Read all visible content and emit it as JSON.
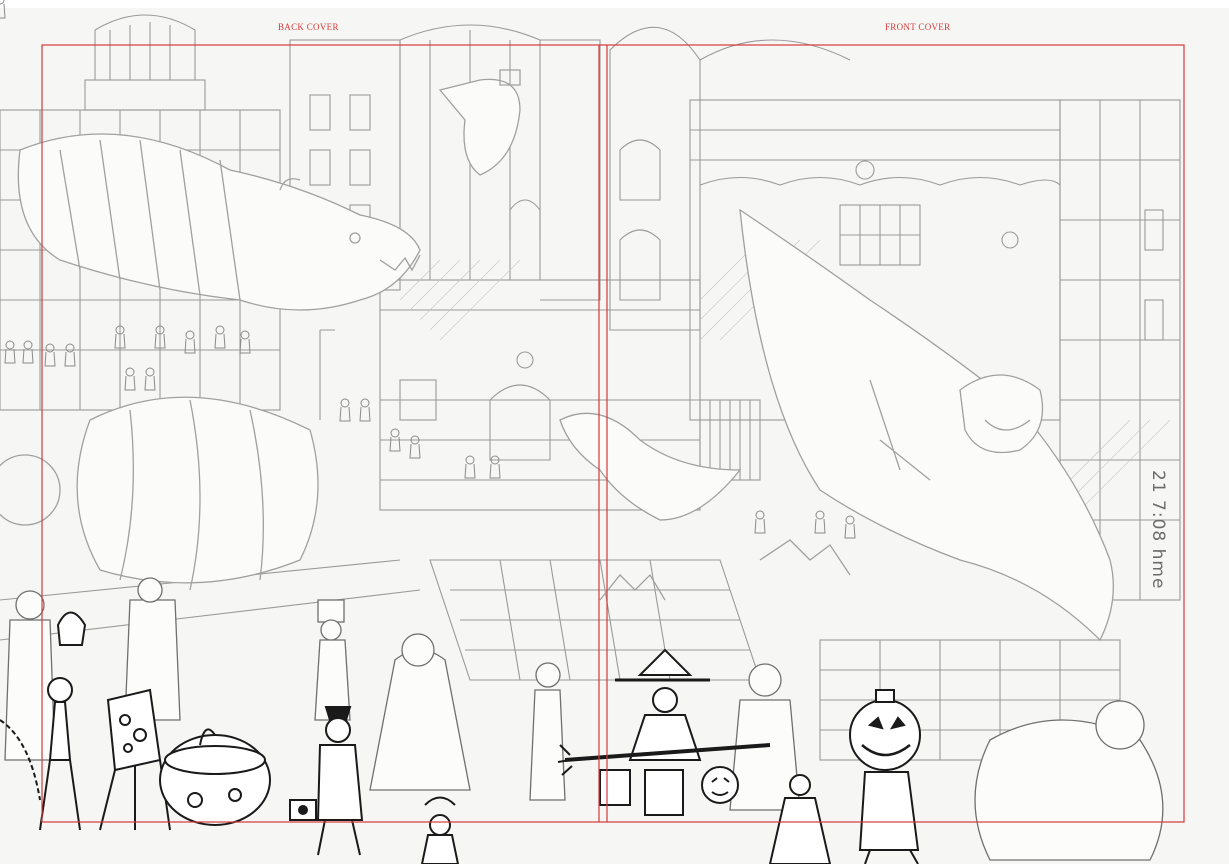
{
  "labels": {
    "back_cover": "BACK COVER",
    "front_cover": "FRONT COVER",
    "date_note": "21 7:08 hme"
  },
  "colors": {
    "guide": "#d63a3a",
    "pencil": "#8a8a8a",
    "pencil_light": "#b8b8b8",
    "ink": "#1a1a1a",
    "paper": "#f6f6f4"
  }
}
